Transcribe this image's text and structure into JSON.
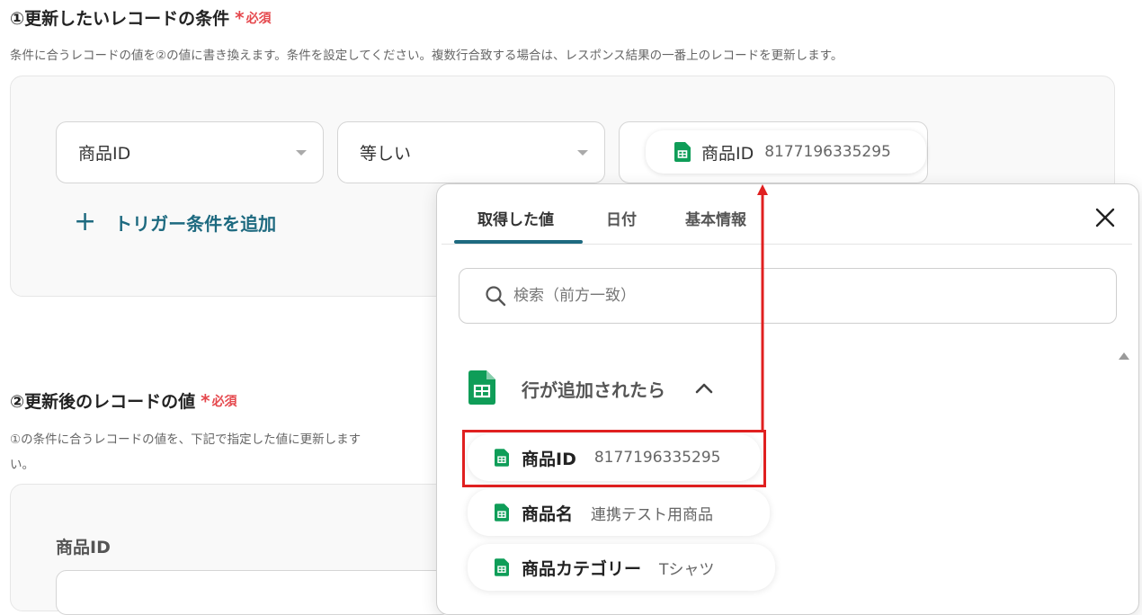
{
  "section1": {
    "title": "①更新したいレコードの条件",
    "required": "必須",
    "description": "条件に合うレコードの値を②の値に書き換えます。条件を設定してください。複数行合致する場合は、レスポンス結果の一番上のレコードを更新します。",
    "field_select": "商品ID",
    "operator_select": "等しい",
    "value_chip": {
      "key": "商品ID",
      "value": "8177196335295"
    },
    "add_condition": "トリガー条件を追加"
  },
  "section2": {
    "title": "②更新後のレコードの値",
    "required": "必須",
    "description_line1": "①の条件に合うレコードの値を、下記で指定した値に更新します",
    "description_line2": "い。",
    "field_label": "商品ID"
  },
  "popup": {
    "tabs": [
      {
        "label": "取得した値",
        "active": true
      },
      {
        "label": "日付",
        "active": false
      },
      {
        "label": "基本情報",
        "active": false
      }
    ],
    "search_placeholder": "検索（前方一致）",
    "group_title": "行が追加されたら",
    "items": [
      {
        "key": "商品ID",
        "value": "8177196335295",
        "highlighted": true
      },
      {
        "key": "商品名",
        "value": "連携テスト用商品",
        "highlighted": false
      },
      {
        "key": "商品カテゴリー",
        "value": "Tシャツ",
        "highlighted": false
      }
    ]
  },
  "colors": {
    "accent": "#1e6a80",
    "required": "#e5484d",
    "annotation": "#e02020",
    "sheets_green": "#0f9d58"
  },
  "icons": [
    "sheets-icon",
    "chevron-down-icon",
    "plus-icon",
    "close-icon",
    "search-icon",
    "chevron-up-icon"
  ]
}
